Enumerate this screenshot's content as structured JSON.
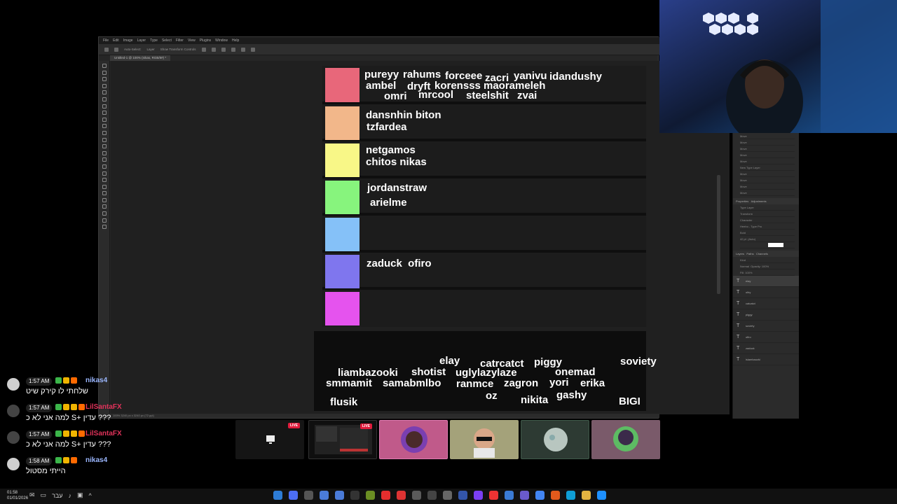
{
  "photoshop": {
    "menus": [
      "File",
      "Edit",
      "Image",
      "Layer",
      "Type",
      "Select",
      "Filter",
      "View",
      "Plugins",
      "Window",
      "Help"
    ],
    "options": {
      "auto_select": "Auto-Select:",
      "layer": "Layer",
      "show_transform": "Show Transform Controls"
    },
    "doc_tab": "Untitled-1 @ 100% (nikas, RGB/8#) *",
    "status": "100%  3240 px x 3240 px (72 ppi)",
    "panels": {
      "history_items": [
        "Move",
        "Move",
        "Move",
        "Move",
        "Move",
        "New Type Layer",
        "Move",
        "Move",
        "Move",
        "Move"
      ],
      "properties_tab": "Properties",
      "adjustments_tab": "Adjustments",
      "type_layer": "Type Layer",
      "transform": "Transform",
      "character": "Character",
      "font": "Heebo - Type Pro",
      "weight": "Bold",
      "size": "42 pt",
      "leading": "(Auto)",
      "layers_tab": "Layers",
      "paths_tab": "Paths",
      "channels_tab": "Channels",
      "kind": "Kind",
      "normal": "Normal",
      "opacity": "Opacity: 100%",
      "fill": "Fill: 100%",
      "layers": [
        "elay",
        "oliry",
        "catcatct",
        "piggy",
        "soviety",
        "ofiro",
        "zaduck",
        "islambaozki"
      ]
    }
  },
  "tiers": [
    {
      "color": "#e8677a",
      "names": [
        "pureyy",
        "rahums",
        "forceee",
        "zacri",
        "yanivu",
        "idandushy",
        "ambel",
        "dryft",
        "korensss",
        "maorameleh",
        "omri",
        "mrcool",
        "steelshit",
        "zvai"
      ]
    },
    {
      "color": "#f2b78a",
      "names": [
        "dansnhin biton",
        "tzfardea"
      ]
    },
    {
      "color": "#f8f787",
      "names": [
        "netgamos",
        "chitos nikas"
      ]
    },
    {
      "color": "#87f47d",
      "names": [
        "jordanstraw",
        "arielme"
      ]
    },
    {
      "color": "#85c1f8",
      "names": []
    },
    {
      "color": "#7f76ee",
      "names": [
        "zaduck  ofiro"
      ]
    },
    {
      "color": "#e553ee",
      "names": []
    }
  ],
  "pool": [
    "elay",
    "catrcatct",
    "piggy",
    "soviety",
    "liambazooki",
    "shotist",
    "uglylazylaze",
    "onemad",
    "smmamit",
    "samabmlbo",
    "ranmce",
    "zagron",
    "yori",
    "erika",
    "flusik",
    "oz",
    "nikita",
    "gashy",
    "BIGI"
  ],
  "chat": [
    {
      "time": "1:57 AM",
      "user": "nikas4",
      "text": "שלחתי לו קירק שיט",
      "red": false,
      "light": true
    },
    {
      "time": "1:57 AM",
      "user": "LilSantaFX",
      "text": "??? עדין +S למה אני לא כ",
      "red": true,
      "light": false
    },
    {
      "time": "1:57 AM",
      "user": "LilSantaFX",
      "text": "??? עדין +S למה אני לא כ",
      "red": true,
      "light": false
    },
    {
      "time": "1:58 AM",
      "user": "nikas4",
      "text": "הייתי מסטול",
      "red": false,
      "light": true
    }
  ],
  "thumbs": [
    {
      "live": "LIVE",
      "color": "#1b1b1b"
    },
    {
      "live": "LIVE",
      "color": "#101010"
    },
    {
      "live": "",
      "color": "#c05a8a"
    },
    {
      "live": "",
      "color": "#a4a27a"
    },
    {
      "live": "",
      "color": "#2d3a33"
    },
    {
      "live": "",
      "color": "#7a5a6a"
    }
  ],
  "taskbar": {
    "time": "01:58",
    "date": "01/01/2026",
    "lang": "עבר",
    "icons": [
      "#2d7cd6",
      "#4c6ef5",
      "#555555",
      "#4a7bd8",
      "#4a7bd8",
      "#333333",
      "#6b8e23",
      "#e62e2e",
      "#d33",
      "#5a5a5a",
      "#444444",
      "#666666",
      "#3355aa",
      "#7b3ff2",
      "#e33",
      "#3a7bd5",
      "#6a5acd",
      "#4285f4",
      "#e25a1c",
      "#0f9ed5",
      "#e3b341",
      "#1e90ff"
    ]
  }
}
